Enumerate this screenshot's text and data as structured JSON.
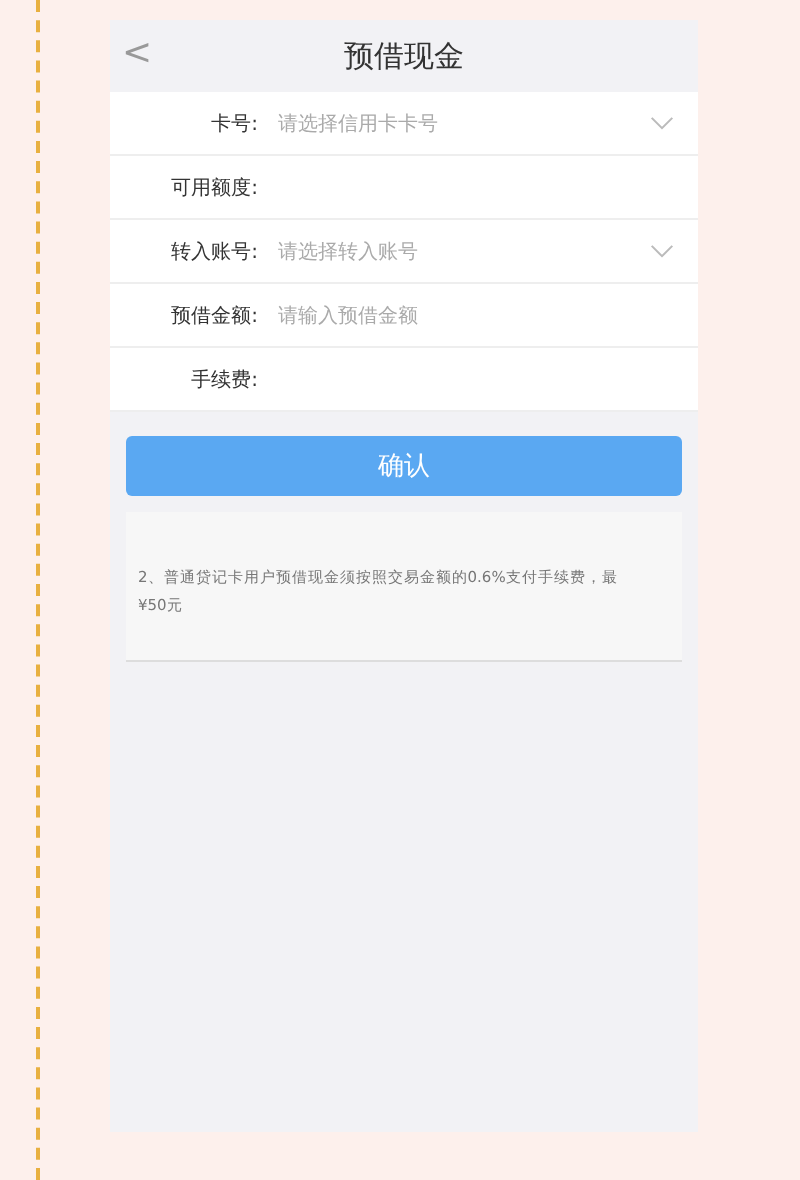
{
  "header": {
    "back": "<",
    "title": "预借现金"
  },
  "fields": [
    {
      "label": "卡号:",
      "placeholder": "请选择信用卡卡号",
      "kind": "select"
    },
    {
      "label": "可用额度:",
      "kind": "text"
    },
    {
      "label": "转入账号:",
      "placeholder": "请选择转入账号",
      "kind": "select"
    },
    {
      "label": "预借金额:",
      "placeholder": "请输入预借金额",
      "kind": "input"
    },
    {
      "label": "手续费:",
      "kind": "text"
    }
  ],
  "confirm_button": "确认",
  "notes": [
    "2、普通贷记卡用户预借现金须按照交易金额的0.6%支付手续费，最",
    "¥50元"
  ]
}
